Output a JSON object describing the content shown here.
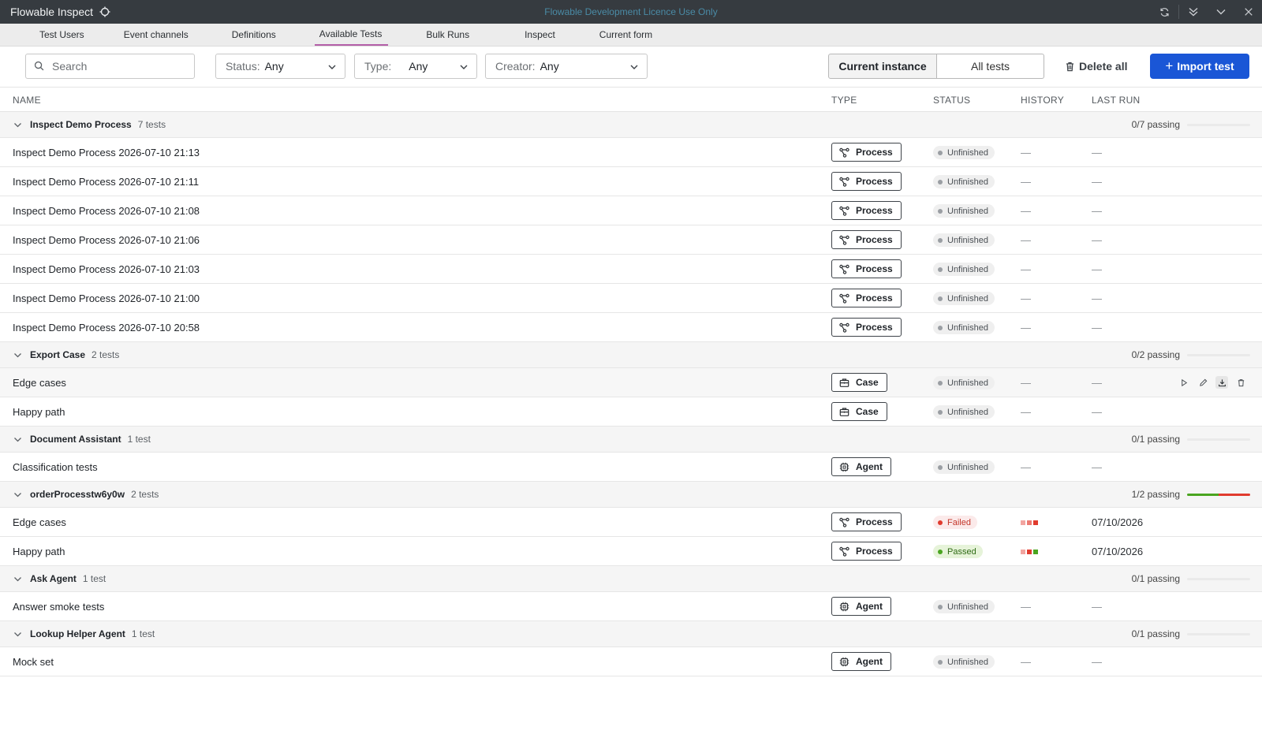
{
  "app": {
    "title": "Flowable Inspect",
    "licence": "Flowable Development Licence Use Only"
  },
  "tabs": [
    {
      "label": "Test Users",
      "active": false
    },
    {
      "label": "Event channels",
      "active": false
    },
    {
      "label": "Definitions",
      "active": false
    },
    {
      "label": "Available Tests",
      "active": true
    },
    {
      "label": "Bulk Runs",
      "active": false
    },
    {
      "label": "Inspect",
      "active": false
    },
    {
      "label": "Current form",
      "active": false
    }
  ],
  "toolbar": {
    "search_placeholder": "Search",
    "status_label": "Status:",
    "status_value": "Any",
    "type_label": "Type:",
    "type_value": "Any",
    "creator_label": "Creator:",
    "creator_value": "Any",
    "current_instance": "Current instance",
    "all_tests": "All tests",
    "delete_all": "Delete all",
    "import_test": "Import test"
  },
  "columns": {
    "name": "NAME",
    "type": "TYPE",
    "status": "STATUS",
    "history": "HISTORY",
    "last_run": "LAST RUN"
  },
  "colors": {
    "accent": "#1a56d6",
    "tab_indicator": "#b45fa8",
    "passed": "#4aa520",
    "failed": "#e03b2e"
  },
  "dash": "—",
  "groups": [
    {
      "name": "Inspect Demo Process",
      "count": "7 tests",
      "passing": "0/7 passing",
      "pass_fraction": 0,
      "fail_fraction": 0,
      "tests": [
        {
          "name": "Inspect Demo Process 2026-07-10 21:13",
          "type": "Process",
          "status": "Unfinished"
        },
        {
          "name": "Inspect Demo Process 2026-07-10 21:11",
          "type": "Process",
          "status": "Unfinished"
        },
        {
          "name": "Inspect Demo Process 2026-07-10 21:08",
          "type": "Process",
          "status": "Unfinished"
        },
        {
          "name": "Inspect Demo Process 2026-07-10 21:06",
          "type": "Process",
          "status": "Unfinished"
        },
        {
          "name": "Inspect Demo Process 2026-07-10 21:03",
          "type": "Process",
          "status": "Unfinished"
        },
        {
          "name": "Inspect Demo Process 2026-07-10 21:00",
          "type": "Process",
          "status": "Unfinished"
        },
        {
          "name": "Inspect Demo Process 2026-07-10 20:58",
          "type": "Process",
          "status": "Unfinished"
        }
      ]
    },
    {
      "name": "Export Case",
      "count": "2 tests",
      "passing": "0/2 passing",
      "pass_fraction": 0,
      "fail_fraction": 0,
      "tests": [
        {
          "name": "Edge cases",
          "type": "Case",
          "status": "Unfinished",
          "hovered": true
        },
        {
          "name": "Happy path",
          "type": "Case",
          "status": "Unfinished"
        }
      ]
    },
    {
      "name": "Document Assistant",
      "count": "1 test",
      "passing": "0/1 passing",
      "pass_fraction": 0,
      "fail_fraction": 0,
      "tests": [
        {
          "name": "Classification tests",
          "type": "Agent",
          "status": "Unfinished"
        }
      ]
    },
    {
      "name": "orderProcesstw6y0w",
      "count": "2 tests",
      "passing": "1/2 passing",
      "pass_fraction": 0.5,
      "fail_fraction": 0.5,
      "tests": [
        {
          "name": "Edge cases",
          "type": "Process",
          "status": "Failed",
          "history": [
            "#f2a5a0",
            "#ec7a72",
            "#e03b2e"
          ],
          "last_run": "07/10/2026"
        },
        {
          "name": "Happy path",
          "type": "Process",
          "status": "Passed",
          "history": [
            "#f2a5a0",
            "#e03b2e",
            "#4aa520"
          ],
          "last_run": "07/10/2026"
        }
      ]
    },
    {
      "name": "Ask Agent",
      "count": "1 test",
      "passing": "0/1 passing",
      "pass_fraction": 0,
      "fail_fraction": 0,
      "tests": [
        {
          "name": "Answer smoke tests",
          "type": "Agent",
          "status": "Unfinished"
        }
      ]
    },
    {
      "name": "Lookup Helper Agent",
      "count": "1 test",
      "passing": "0/1 passing",
      "pass_fraction": 0,
      "fail_fraction": 0,
      "tests": [
        {
          "name": "Mock set",
          "type": "Agent",
          "status": "Unfinished"
        }
      ]
    }
  ]
}
